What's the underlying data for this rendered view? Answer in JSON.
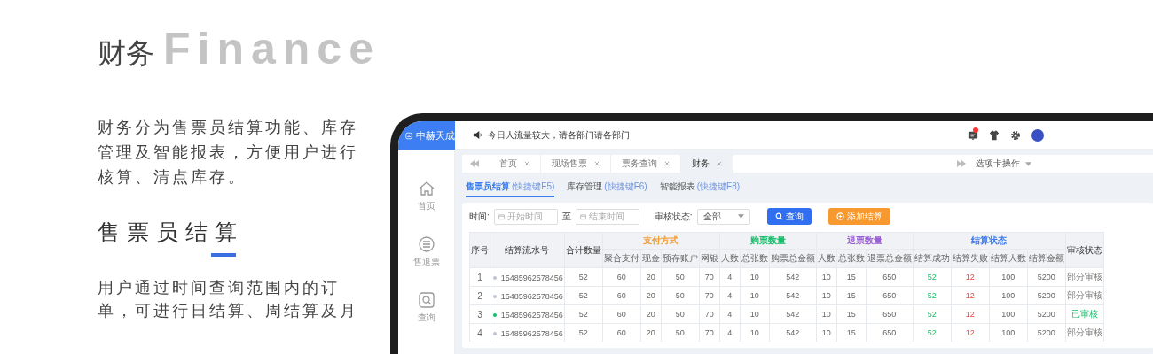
{
  "intro": {
    "title": "财务",
    "watermark": "Finance",
    "description": "财务分为售票员结算功能、库存管理及智能报表，方便用户进行核算、清点库存。",
    "section_title": "售票员结算",
    "section_text": "用户通过时间查询范围内的订单，可进行日结算、周结算及月"
  },
  "app": {
    "logo": "中赫天成",
    "notice": "今日人流量较大，请各部门请各部门",
    "has_unread": true,
    "sidebar": [
      {
        "label": "首页",
        "kind": "home",
        "selected": false
      },
      {
        "label": "售退票",
        "kind": "ticket",
        "selected": false
      },
      {
        "label": "查询",
        "kind": "search",
        "selected": false
      }
    ],
    "tabs": [
      {
        "label": "首页",
        "selected": false
      },
      {
        "label": "现场售票",
        "selected": false
      },
      {
        "label": "票务查询",
        "selected": false
      },
      {
        "label": "财务",
        "selected": true
      }
    ],
    "tab_menu": "选项卡操作",
    "subtabs": [
      {
        "label": "售票员结算",
        "shortcut": "(快捷键F5)",
        "selected": true
      },
      {
        "label": "库存管理",
        "shortcut": "(快捷键F6)",
        "selected": false
      },
      {
        "label": "智能报表",
        "shortcut": "(快捷键F8)",
        "selected": false
      }
    ],
    "filters": {
      "time_label": "时间:",
      "start_placeholder": "开始时间",
      "separator": "至",
      "end_placeholder": "结束时间",
      "status_label": "审核状态:",
      "status_value": "全部",
      "search_button": "查询",
      "add_button": "添加结算"
    },
    "table": {
      "fixed_columns": [
        "序号",
        "结算流水号",
        "合计数量"
      ],
      "groups": [
        {
          "title": "支付方式",
          "color": "#f39a2e",
          "columns": [
            "聚合支付",
            "现金",
            "预存账户",
            "网银"
          ]
        },
        {
          "title": "购票数量",
          "color": "#19be6b",
          "columns": [
            "人数",
            "总张数",
            "购票总金额"
          ]
        },
        {
          "title": "退票数量",
          "color": "#9b5fd6",
          "columns": [
            "人数",
            "总张数",
            "退票总金额"
          ]
        },
        {
          "title": "结算状态",
          "color": "#3a7bf0",
          "columns": [
            "结算成功",
            "结算失败",
            "结算人数",
            "结算金额"
          ]
        }
      ],
      "status_column": "审核状态",
      "rows": [
        {
          "index": "1",
          "serial": "15485962578456",
          "color": "#c0c4cc",
          "total": "52",
          "groups": [
            [
              "60",
              "20",
              "50",
              "70"
            ],
            [
              "4",
              "10",
              "542"
            ],
            [
              "10",
              "15",
              "650"
            ],
            [
              "52",
              "12",
              "100",
              "5200"
            ]
          ],
          "status": "部分审核",
          "kind": "partial"
        },
        {
          "index": "2",
          "serial": "15485962578456",
          "color": "#c0c4cc",
          "total": "52",
          "groups": [
            [
              "60",
              "20",
              "50",
              "70"
            ],
            [
              "4",
              "10",
              "542"
            ],
            [
              "10",
              "15",
              "650"
            ],
            [
              "52",
              "12",
              "100",
              "5200"
            ]
          ],
          "status": "部分审核",
          "kind": "partial"
        },
        {
          "index": "3",
          "serial": "15485962578456",
          "color": "#19be6b",
          "total": "52",
          "groups": [
            [
              "60",
              "20",
              "50",
              "70"
            ],
            [
              "4",
              "10",
              "542"
            ],
            [
              "10",
              "15",
              "650"
            ],
            [
              "52",
              "12",
              "100",
              "5200"
            ]
          ],
          "status": "已审核",
          "kind": "approved"
        },
        {
          "index": "4",
          "serial": "15485962578456",
          "color": "#c0c4cc",
          "total": "52",
          "groups": [
            [
              "60",
              "20",
              "50",
              "70"
            ],
            [
              "4",
              "10",
              "542"
            ],
            [
              "10",
              "15",
              "650"
            ],
            [
              "52",
              "12",
              "100",
              "5200"
            ]
          ],
          "status": "部分审核",
          "kind": "partial"
        }
      ]
    }
  }
}
